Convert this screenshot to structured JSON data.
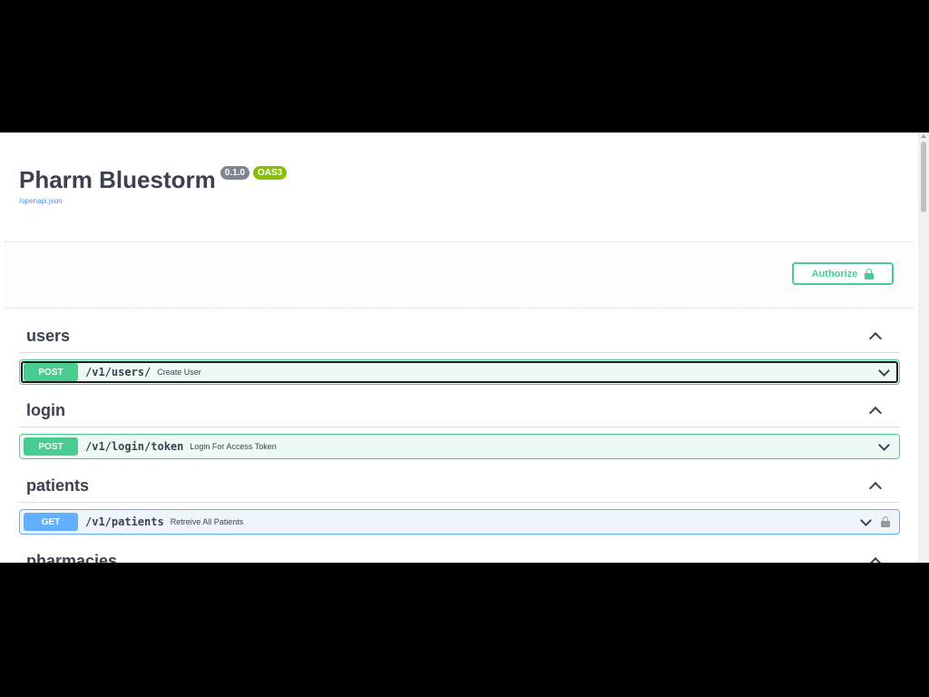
{
  "info": {
    "title": "Pharm Bluestorm",
    "version": "0.1.0",
    "oas": "OAS3",
    "spec_link": "/openapi.json"
  },
  "authorize": {
    "label": "Authorize"
  },
  "tags": [
    {
      "name": "users",
      "operations": [
        {
          "method": "POST",
          "path": "/v1/users/",
          "summary": "Create User"
        }
      ]
    },
    {
      "name": "login",
      "operations": [
        {
          "method": "POST",
          "path": "/v1/login/token",
          "summary": "Login For Access Token"
        }
      ]
    },
    {
      "name": "patients",
      "operations": [
        {
          "method": "GET",
          "path": "/v1/patients",
          "summary": "Retreive All Patients"
        }
      ]
    },
    {
      "name": "pharmacies",
      "operations": []
    }
  ],
  "colors": {
    "post": "#49cc90",
    "get": "#61affe",
    "text": "#3b4151"
  }
}
